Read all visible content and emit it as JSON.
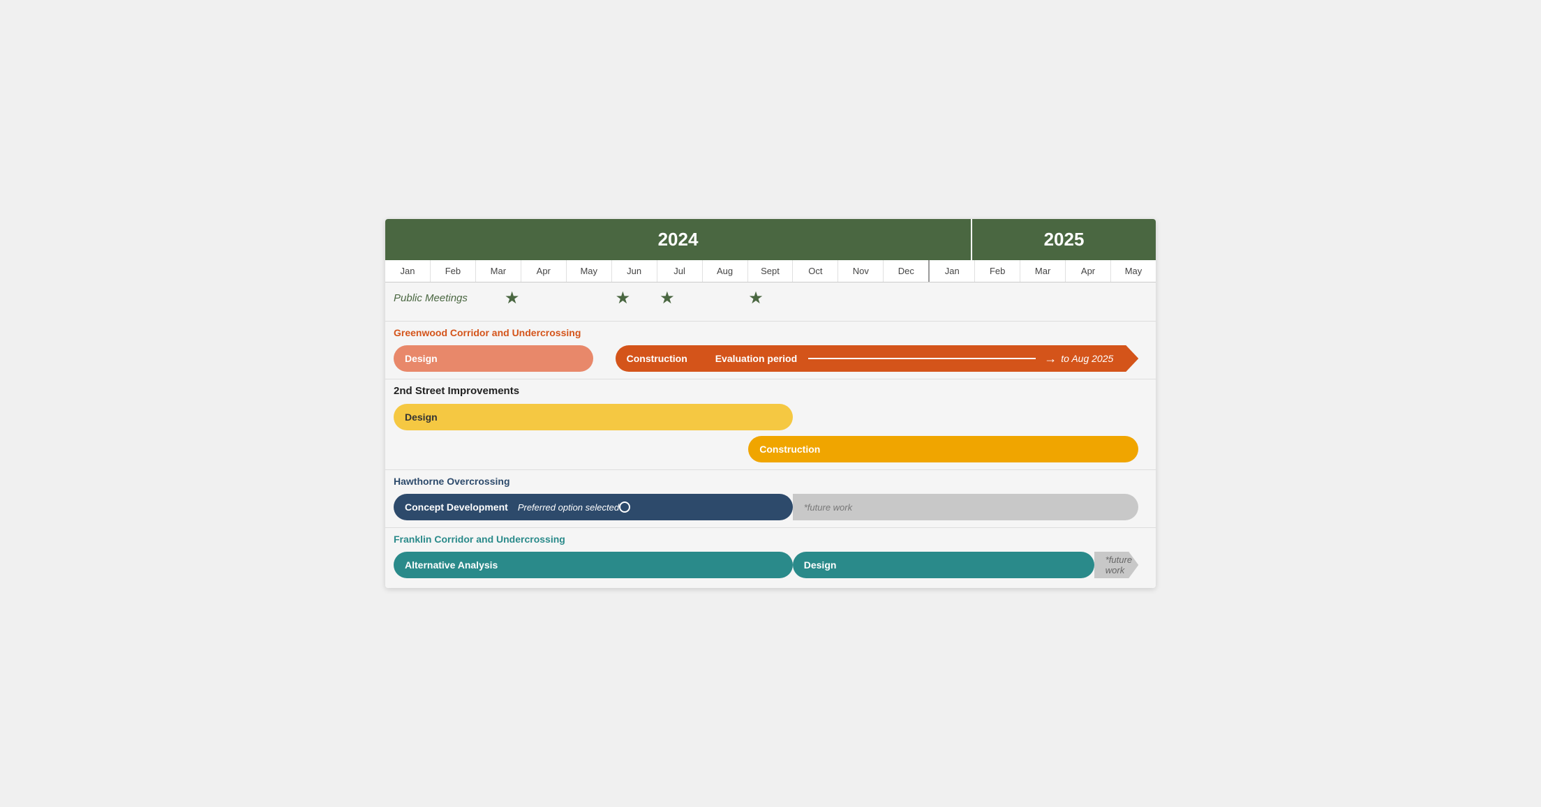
{
  "years": {
    "y2024": "2024",
    "y2025": "2025"
  },
  "months_2024": [
    "Jan",
    "Feb",
    "Mar",
    "Apr",
    "May",
    "Jun",
    "Jul",
    "Aug",
    "Sept",
    "Oct",
    "Nov",
    "Dec"
  ],
  "months_2025": [
    "Jan",
    "Feb",
    "Mar",
    "Apr",
    "May"
  ],
  "public_meetings": {
    "label": "Public Meetings",
    "stars": [
      {
        "month_offset": 2.5
      },
      {
        "month_offset": 5.0
      },
      {
        "month_offset": 6.0
      },
      {
        "month_offset": 8.0
      }
    ]
  },
  "sections": [
    {
      "id": "greenwood",
      "label": "Greenwood Corridor and Undercrossing",
      "label_color": "orange",
      "bars": [
        {
          "id": "gw-design",
          "label": "Design",
          "color": "#e8886a",
          "start": 0,
          "end": 4.5,
          "rounded": "both"
        },
        {
          "id": "gw-construction",
          "label": "Construction",
          "color": "#d4541a",
          "start": 5.0,
          "end": 7.0,
          "rounded": "left"
        },
        {
          "id": "gw-eval",
          "label": "Evaluation period",
          "color": "#d4541a",
          "start": 7.0,
          "end": 16.8,
          "type": "arrow",
          "extra": "to Aug 2025"
        }
      ]
    },
    {
      "id": "second-street",
      "label": "2nd Street Improvements",
      "label_color": "black",
      "bars": [
        {
          "id": "ss-design",
          "label": "Design",
          "color": "#f5c842",
          "start": 0,
          "end": 9.0,
          "rounded": "both"
        },
        {
          "id": "ss-construction",
          "label": "Construction",
          "color": "#f0a500",
          "start": 8.0,
          "end": 16.8,
          "rounded": "both"
        }
      ]
    },
    {
      "id": "hawthorne",
      "label": "Hawthorne Overcrossing",
      "label_color": "dark-blue",
      "bars": [
        {
          "id": "hw-concept",
          "label": "Concept Development",
          "sub": "Preferred option selected",
          "color": "#2d4a6b",
          "start": 0,
          "end": 9.0,
          "rounded": "both",
          "type": "concept"
        },
        {
          "id": "hw-future",
          "label": "*future work",
          "color": "#c8c8c8",
          "start": 9.0,
          "end": 16.8,
          "type": "future"
        }
      ]
    },
    {
      "id": "franklin",
      "label": "Franklin Corridor and Undercrossing",
      "label_color": "teal",
      "bars": [
        {
          "id": "fr-altanalysis",
          "label": "Alternative Analysis",
          "color": "#2a8a8a",
          "start": 0,
          "end": 9.0,
          "rounded": "both"
        },
        {
          "id": "fr-design",
          "label": "Design",
          "color": "#2a8a8a",
          "start": 9.0,
          "end": 15.8,
          "rounded": "both"
        },
        {
          "id": "fr-future",
          "label": "*future work",
          "color": "#c8c8c8",
          "start": 15.8,
          "end": 16.8,
          "type": "future-arrow"
        }
      ]
    }
  ],
  "colors": {
    "header_green": "#4a6741",
    "orange_dark": "#d4541a",
    "orange_light": "#e8886a",
    "yellow": "#f5c842",
    "amber": "#f0a500",
    "dark_blue": "#2d4a6b",
    "teal": "#2a8a8a",
    "gray": "#c8c8c8"
  }
}
